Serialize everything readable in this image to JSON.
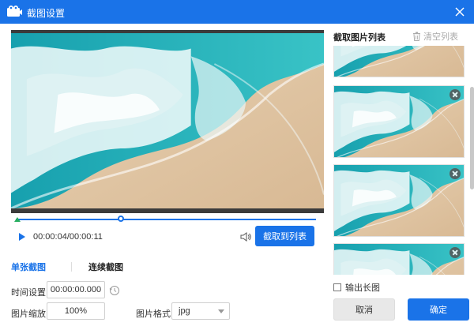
{
  "window": {
    "title": "截图设置"
  },
  "player": {
    "timecode": "00:00:04/00:00:11",
    "progress": 0.35,
    "capture_label": "截取到列表"
  },
  "modes": {
    "single_label": "单张截图",
    "continuous_label": "连续截图"
  },
  "settings": {
    "time_label": "时间设置:",
    "time_value": "00:00:00.000",
    "scale_label": "图片缩放:",
    "scale_value": "100%",
    "format_label": "图片格式:",
    "format_value": "jpg"
  },
  "list": {
    "title": "截取图片列表",
    "clear_label": "清空列表",
    "item_count_visible": 4
  },
  "footer": {
    "export_long_label": "输出长图",
    "export_long_checked": false,
    "cancel_label": "取消",
    "ok_label": "确定"
  },
  "colors": {
    "accent": "#1a73e8",
    "titlebar": "#1a73e8",
    "start_marker": "#27ae60"
  }
}
